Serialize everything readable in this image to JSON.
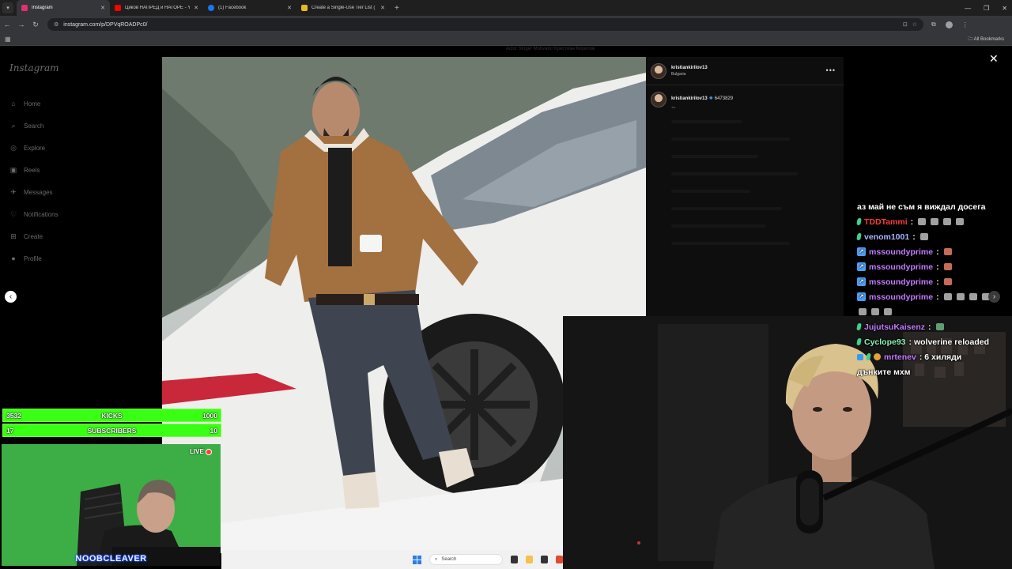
{
  "browser": {
    "tabs": [
      {
        "title": "Instagram",
        "active": true,
        "favicon_color": "#e1306c"
      },
      {
        "title": "Циков НАПРЕД и НАГОРЕ - Yo",
        "active": false,
        "favicon_color": "#ff0000"
      },
      {
        "title": "(1) Facebook",
        "active": false,
        "favicon_color": "#1877f2"
      },
      {
        "title": "Create a Single-Use Tier List (",
        "active": false,
        "favicon_color": "#e8b923"
      }
    ],
    "url": "instagram.com/p/DPVqROADPc0/",
    "all_bookmarks": "All Bookmarks"
  },
  "instagram": {
    "logo": "Instagram",
    "nav": [
      {
        "label": "Home",
        "icon": "home-icon",
        "glyph": "⌂"
      },
      {
        "label": "Search",
        "icon": "search-icon",
        "glyph": "⌕"
      },
      {
        "label": "Explore",
        "icon": "compass-icon",
        "glyph": "◎"
      },
      {
        "label": "Reels",
        "icon": "reels-icon",
        "glyph": "▣"
      },
      {
        "label": "Messages",
        "icon": "messages-icon",
        "glyph": "✈"
      },
      {
        "label": "Notifications",
        "icon": "heart-icon",
        "glyph": "♡"
      },
      {
        "label": "Create",
        "icon": "plus-icon",
        "glyph": "⊞"
      },
      {
        "label": "Profile",
        "icon": "profile-icon",
        "glyph": "●"
      }
    ],
    "bg_strip": "Actor   Singer   Motivator   Кристиан Кирилов"
  },
  "post": {
    "username": "kristiankirilov13",
    "location": "Bulgaria",
    "caption_number": "6473829",
    "time": "1w"
  },
  "chat": [
    {
      "badge": "",
      "user": "",
      "user_class": "",
      "text": "аз май не съм я виждал досега",
      "emotes": 0
    },
    {
      "badge": "green",
      "user": "TDDTammi",
      "user_class": "un-red",
      "text": ":",
      "emotes": 4
    },
    {
      "badge": "green",
      "user": "venom1001",
      "user_class": "un-blue",
      "text": ":",
      "emotes": 1
    },
    {
      "badge": "prime",
      "user": "mssoundyprime",
      "user_class": "un-purple",
      "text": ":",
      "emotes": 1
    },
    {
      "badge": "prime",
      "user": "mssoundyprime",
      "user_class": "un-purple",
      "text": ":",
      "emotes": 1
    },
    {
      "badge": "prime",
      "user": "mssoundyprime",
      "user_class": "un-purple",
      "text": ":",
      "emotes": 1
    },
    {
      "badge": "prime",
      "user": "mssoundyprime",
      "user_class": "un-purple",
      "text": ":",
      "emotes": 4
    },
    {
      "badge": "",
      "user": "",
      "user_class": "",
      "text": "",
      "emotes": 3
    },
    {
      "badge": "green",
      "user": "JujutsuKaisenz",
      "user_class": "un-purple",
      "text": ":",
      "emotes": 1
    },
    {
      "badge": "green",
      "user": "Cyclope93",
      "user_class": "un-green",
      "text": ": wolverine reloaded",
      "emotes": 0
    },
    {
      "badge": "multi",
      "user": "mrtenev",
      "user_class": "un-purple",
      "text": ": 6 хиляди",
      "emotes": 0
    },
    {
      "badge": "",
      "user": "",
      "user_class": "",
      "text": "дънките мхм",
      "emotes": 0
    }
  ],
  "stream": {
    "kicks_current": "3532",
    "kicks_label": "KICKS",
    "kicks_goal": "1000",
    "kicks_progress": 1.0,
    "subs_current": "17",
    "subs_label": "SUBSCRIBERS",
    "subs_goal": "10",
    "subs_progress": 1.0,
    "live_label": "LIVE",
    "streamer_name": "NOOBCLEAVER",
    "accent": "#39ff14"
  },
  "taskbar": {
    "search_placeholder": "Search"
  }
}
